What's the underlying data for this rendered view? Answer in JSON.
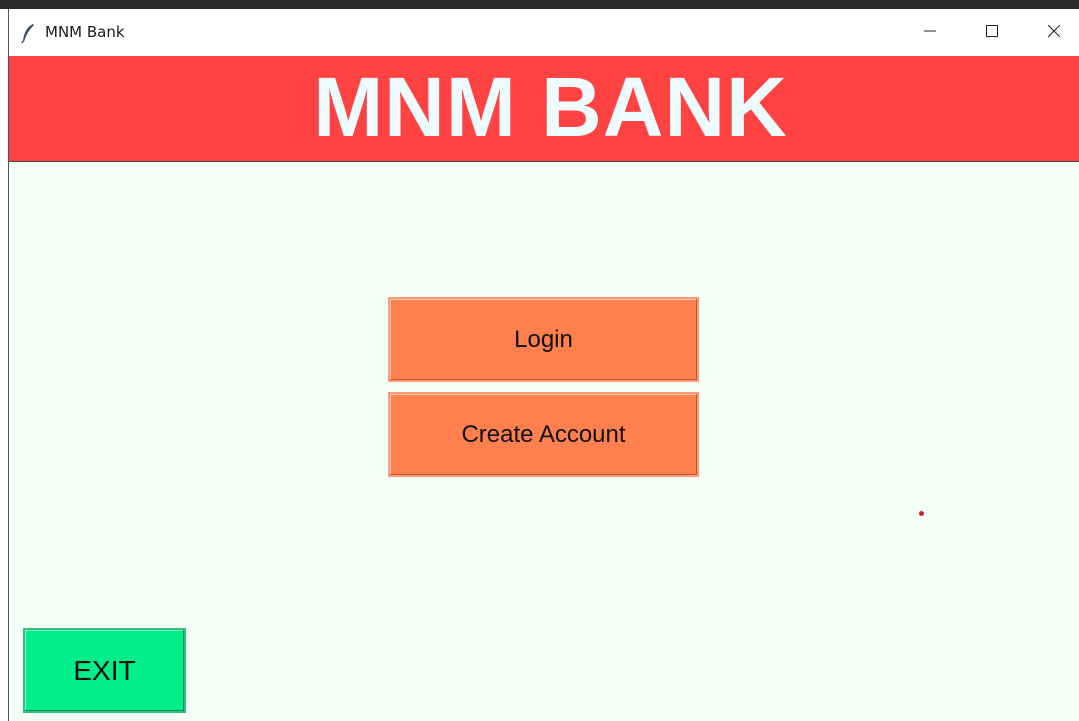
{
  "window": {
    "title": "MNM Bank",
    "icon": "feather-icon",
    "controls": {
      "minimize_icon": "minimize-icon",
      "maximize_icon": "maximize-icon",
      "close_icon": "close-icon"
    }
  },
  "banner": {
    "title": "MNM BANK",
    "background": "#ff4242",
    "text_color": "#eefbff"
  },
  "actions": {
    "login_label": "Login",
    "create_account_label": "Create Account",
    "exit_label": "EXIT",
    "primary_color": "#ff7f4f",
    "exit_color": "#00ee8a"
  },
  "colors": {
    "window_background": "#f5fff8"
  }
}
